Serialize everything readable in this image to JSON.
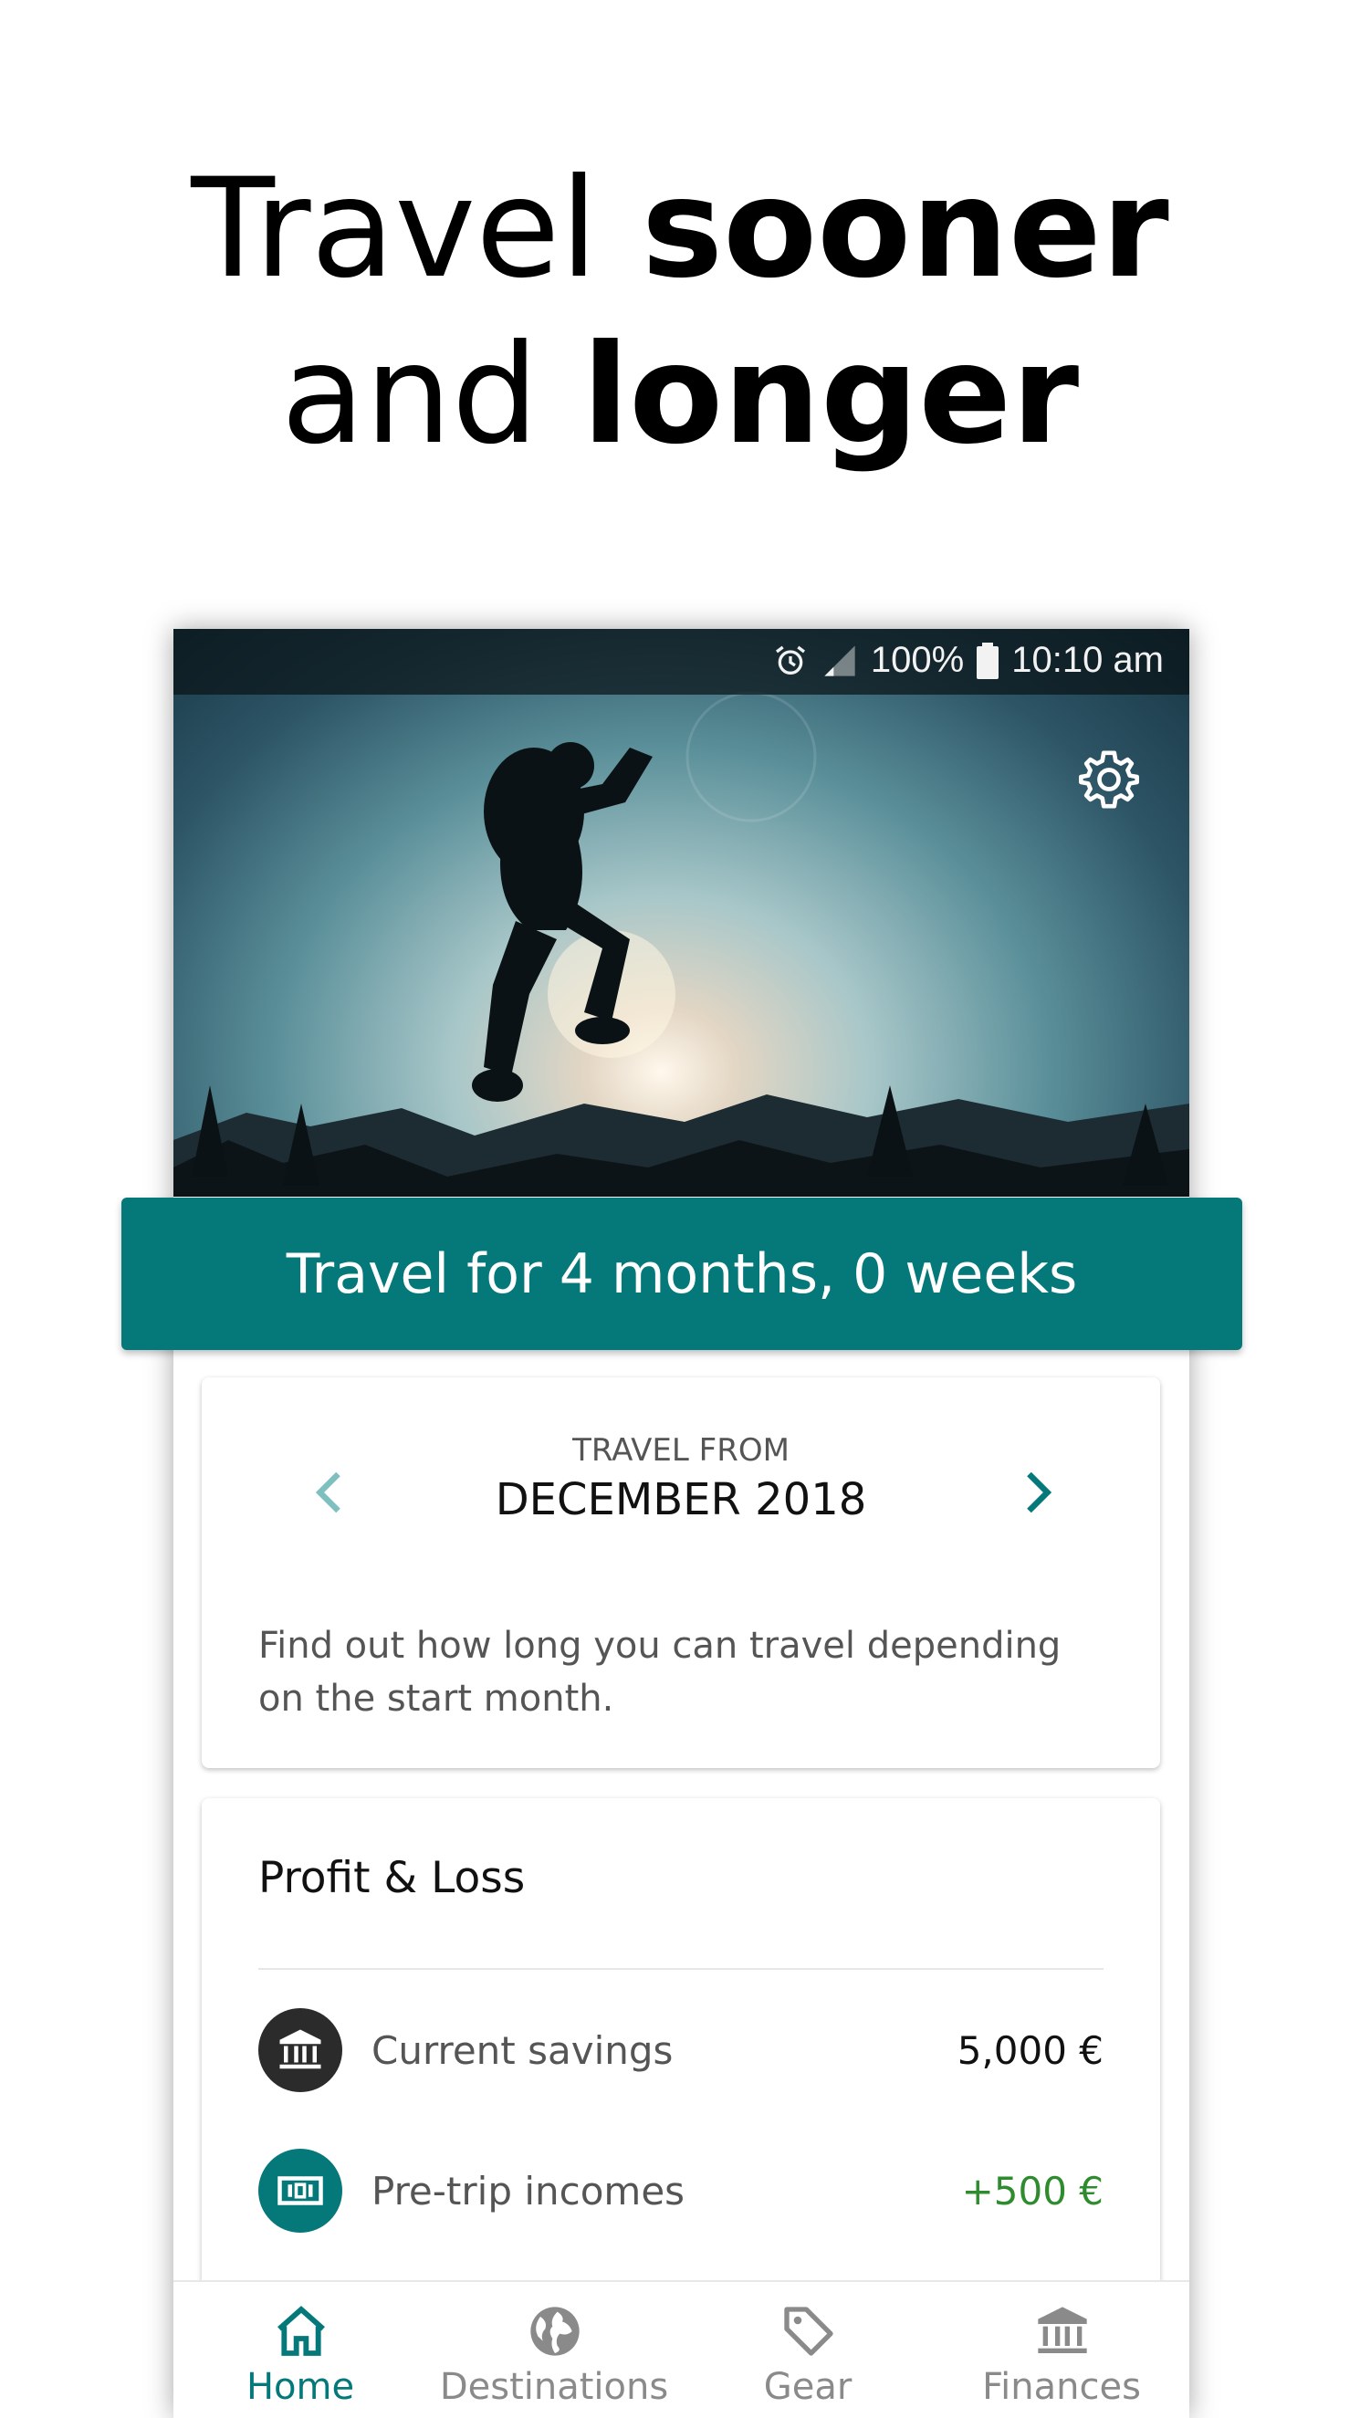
{
  "headline": {
    "line1_regular": "Travel ",
    "line1_bold": "sooner",
    "line2_regular": "and ",
    "line2_bold": "longer"
  },
  "status_bar": {
    "battery": "100%",
    "time": "10:10 am",
    "icons": [
      "alarm-icon",
      "signal-icon",
      "battery-icon"
    ]
  },
  "hero": {
    "settings_icon": "gear-icon"
  },
  "banner": {
    "text": "Travel for 4 months, 0 weeks"
  },
  "travel_from": {
    "label": "TRAVEL FROM",
    "month": "DECEMBER 2018",
    "description": "Find out how long you can travel depending on the start month."
  },
  "profit_loss": {
    "title": "Profit & Loss",
    "rows": [
      {
        "label": "Current savings",
        "value": "5,000 €",
        "icon": "bank-icon"
      },
      {
        "label": "Pre-trip incomes",
        "value": "+500 €",
        "icon": "cash-icon"
      }
    ]
  },
  "bottom_nav": {
    "items": [
      {
        "label": "Home",
        "icon": "home-icon",
        "active": true
      },
      {
        "label": "Destinations",
        "icon": "globe-icon",
        "active": false
      },
      {
        "label": "Gear",
        "icon": "tag-icon",
        "active": false
      },
      {
        "label": "Finances",
        "icon": "bank-icon",
        "active": false
      }
    ]
  },
  "colors": {
    "primary": "#05787a",
    "positive": "#2e8b2e",
    "dark_icon": "#2b2b2b"
  }
}
